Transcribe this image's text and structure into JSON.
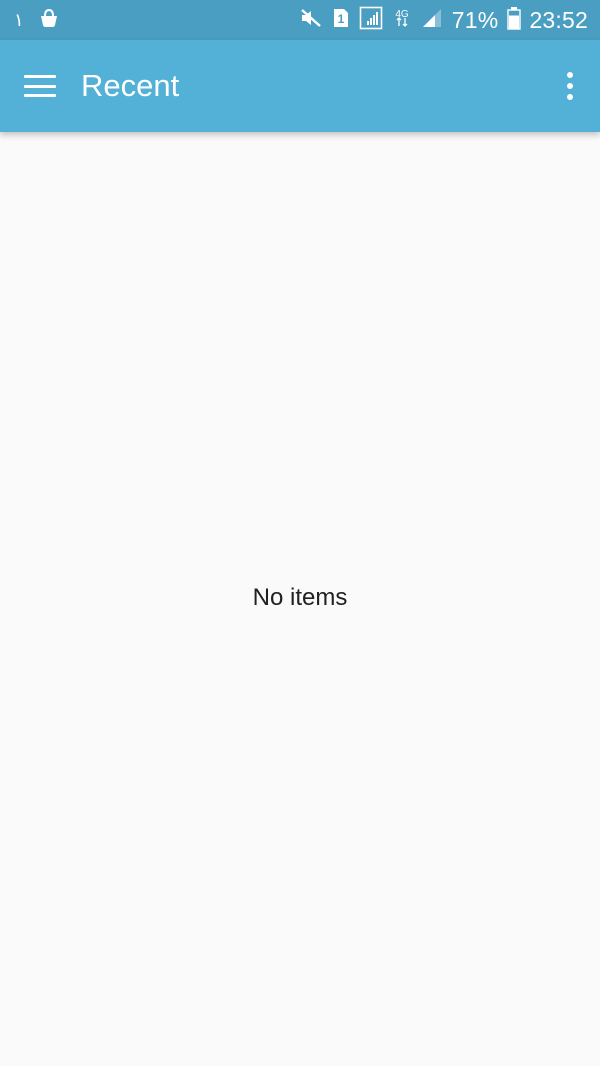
{
  "status_bar": {
    "left_digit": "١",
    "icons": [
      "bag-notification-icon",
      "mute-icon",
      "sim-1-icon",
      "signal-icon",
      "4g-data-icon",
      "signal-icon"
    ],
    "battery_percent": "71%",
    "time": "23:52"
  },
  "app_bar": {
    "title": "Recent",
    "menu_icon": "hamburger-menu-icon",
    "overflow_icon": "more-vert-icon",
    "color": "#53b0d7"
  },
  "content": {
    "empty_message": "No items"
  },
  "colors": {
    "status_bar": "#4a9ec2",
    "app_bar": "#53b0d7",
    "background": "#fafafa"
  }
}
